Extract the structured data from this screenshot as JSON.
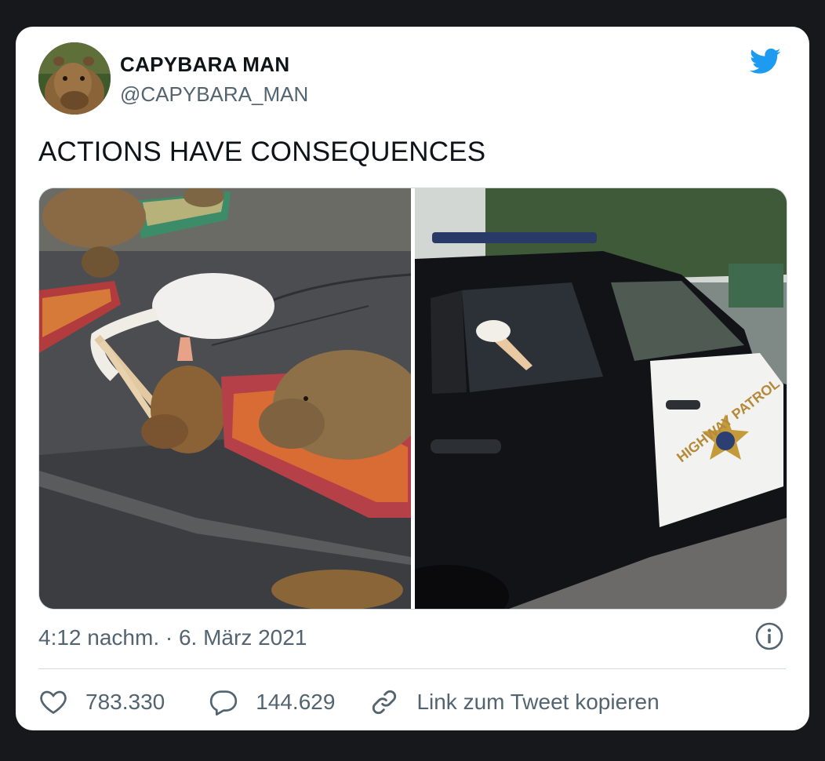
{
  "tweet": {
    "author": {
      "name": "CAPYBARA MAN",
      "handle": "@CAPYBARA_MAN"
    },
    "text": "ACTIONS HAVE CONSEQUENCES",
    "media": {
      "left_photo": "capybaras-and-pelican-photo",
      "right_photo": "pelican-in-highway-patrol-car-photo",
      "car_door_lettering": "HIGHWAY PATROL"
    },
    "timestamp": "4:12 nachm. · 6. März 2021",
    "actions": {
      "likes": "783.330",
      "replies": "144.629",
      "copy_link_label": "Link zum Tweet kopieren"
    }
  },
  "colors": {
    "twitter_blue": "#1d9bf0",
    "secondary_text": "#536471",
    "primary_text": "#0f1419",
    "divider": "#cfd9de",
    "page_background": "#17181b"
  },
  "icons": {
    "brand": "twitter-bird-icon",
    "info": "info-icon",
    "like": "heart-icon",
    "reply": "speech-bubble-icon",
    "copy_link": "link-icon"
  }
}
